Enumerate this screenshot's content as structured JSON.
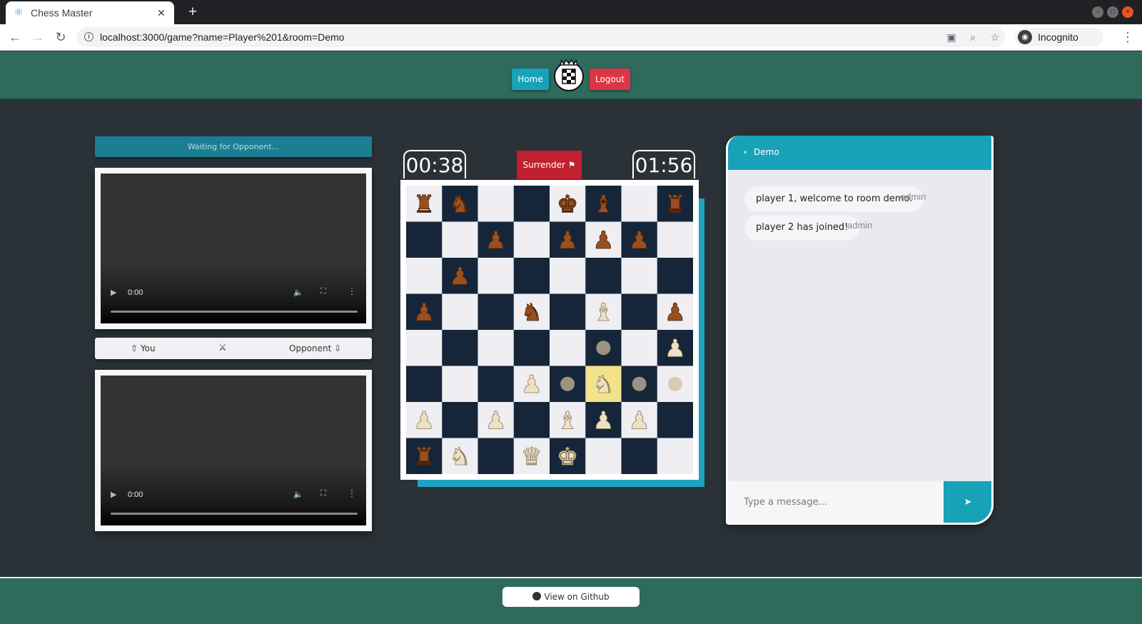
{
  "browser": {
    "tab_title": "Chess Master",
    "url": "localhost:3000/game?name=Player%201&room=Demo",
    "profile_label": "Incognito"
  },
  "header": {
    "home_label": "Home",
    "logout_label": "Logout"
  },
  "left": {
    "status": "Waiting for Opponent...",
    "video_time": "0:00",
    "you_label": "You",
    "opponent_label": "Opponent"
  },
  "game": {
    "timer_left": "00:38",
    "timer_right": "01:56",
    "surrender_label": "Surrender",
    "board": [
      [
        "bR",
        "bN",
        "",
        "",
        "bK",
        "bB",
        "",
        "bR"
      ],
      [
        "",
        "",
        "bP",
        "",
        "bP",
        "bP",
        "bP",
        ""
      ],
      [
        "",
        "bP",
        "",
        "",
        "",
        "",
        "",
        ""
      ],
      [
        "bP",
        "",
        "",
        "bN",
        "",
        "wB",
        "",
        "bP"
      ],
      [
        "",
        "",
        "",
        "",
        "",
        "",
        "",
        "wP"
      ],
      [
        "",
        "",
        "",
        "wP",
        "",
        "wN",
        "",
        ""
      ],
      [
        "wP",
        "",
        "wP",
        "",
        "wB",
        "wP",
        "wP",
        ""
      ],
      [
        "bR",
        "wN",
        "",
        "wQ",
        "wK",
        "",
        "",
        ""
      ]
    ],
    "highlight": [
      [
        5,
        5
      ]
    ],
    "move_dots": [
      [
        4,
        5
      ],
      [
        5,
        4
      ],
      [
        5,
        6
      ]
    ],
    "capture_hints": [
      [
        5,
        7
      ]
    ],
    "colors": {
      "light": "#eeeef3",
      "dark": "#16263a",
      "highlight": "#f3e28c",
      "dot": "#9c9280",
      "capture": "#d7cbb4"
    }
  },
  "chat": {
    "room": "Demo",
    "messages": [
      {
        "text": "player 1, welcome to room demo.",
        "sender": "admin"
      },
      {
        "text": "player 2 has joined!",
        "sender": "admin"
      }
    ],
    "placeholder": "Type a message..."
  },
  "footer": {
    "github_label": "View on Github"
  }
}
